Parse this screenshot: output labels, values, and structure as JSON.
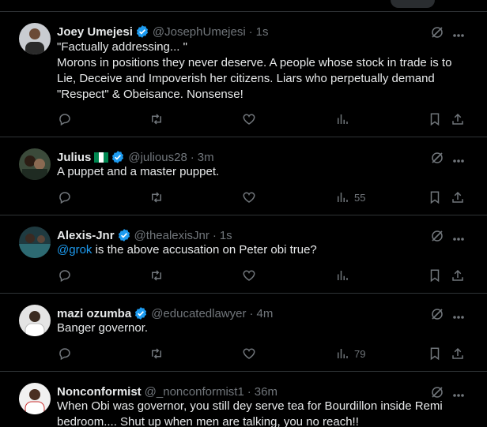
{
  "tweets": [
    {
      "name": "Joey Umejesi",
      "handle": "@JosephUmejesi",
      "time": "1s",
      "lines": [
        "\"Factually addressing... \"",
        "Morons in positions they never deserve. A people whose stock in trade is to Lie, Deceive and Impoverish her citizens. Liars who perpetually demand \"Respect\" & Obeisance. Nonsense!"
      ],
      "views": ""
    },
    {
      "name": "Julius",
      "handle": "@julious28",
      "time": "3m",
      "lines": [
        "A puppet and a master puppet."
      ],
      "views": "55"
    },
    {
      "name": "Alexis-Jnr",
      "handle": "@thealexisJnr",
      "time": "1s",
      "mention": "@grok",
      "lines": [
        " is the above accusation on Peter obi true?"
      ],
      "views": ""
    },
    {
      "name": "mazi ozumba",
      "handle": "@educatedlawyer",
      "time": "4m",
      "lines": [
        "Banger governor."
      ],
      "views": "79"
    },
    {
      "name": "Nonconformist",
      "handle": "@_nonconformist1",
      "time": "36m",
      "lines": [
        "When Obi was governor, you still dey serve tea for Bourdillon inside Remi bedroom.... Shut up when men are talking, you no reach!!"
      ],
      "views": ""
    }
  ],
  "dot": "·",
  "colors": {
    "background": "#000000",
    "text": "#e7e9ea",
    "muted": "#71767b",
    "accent": "#1d9bf0",
    "divider": "#2f3336"
  },
  "icons": [
    "verified-badge-icon",
    "nigeria-flag-icon",
    "grok-icon",
    "more-icon",
    "reply-icon",
    "retweet-icon",
    "like-icon",
    "views-icon",
    "bookmark-icon",
    "share-icon"
  ]
}
